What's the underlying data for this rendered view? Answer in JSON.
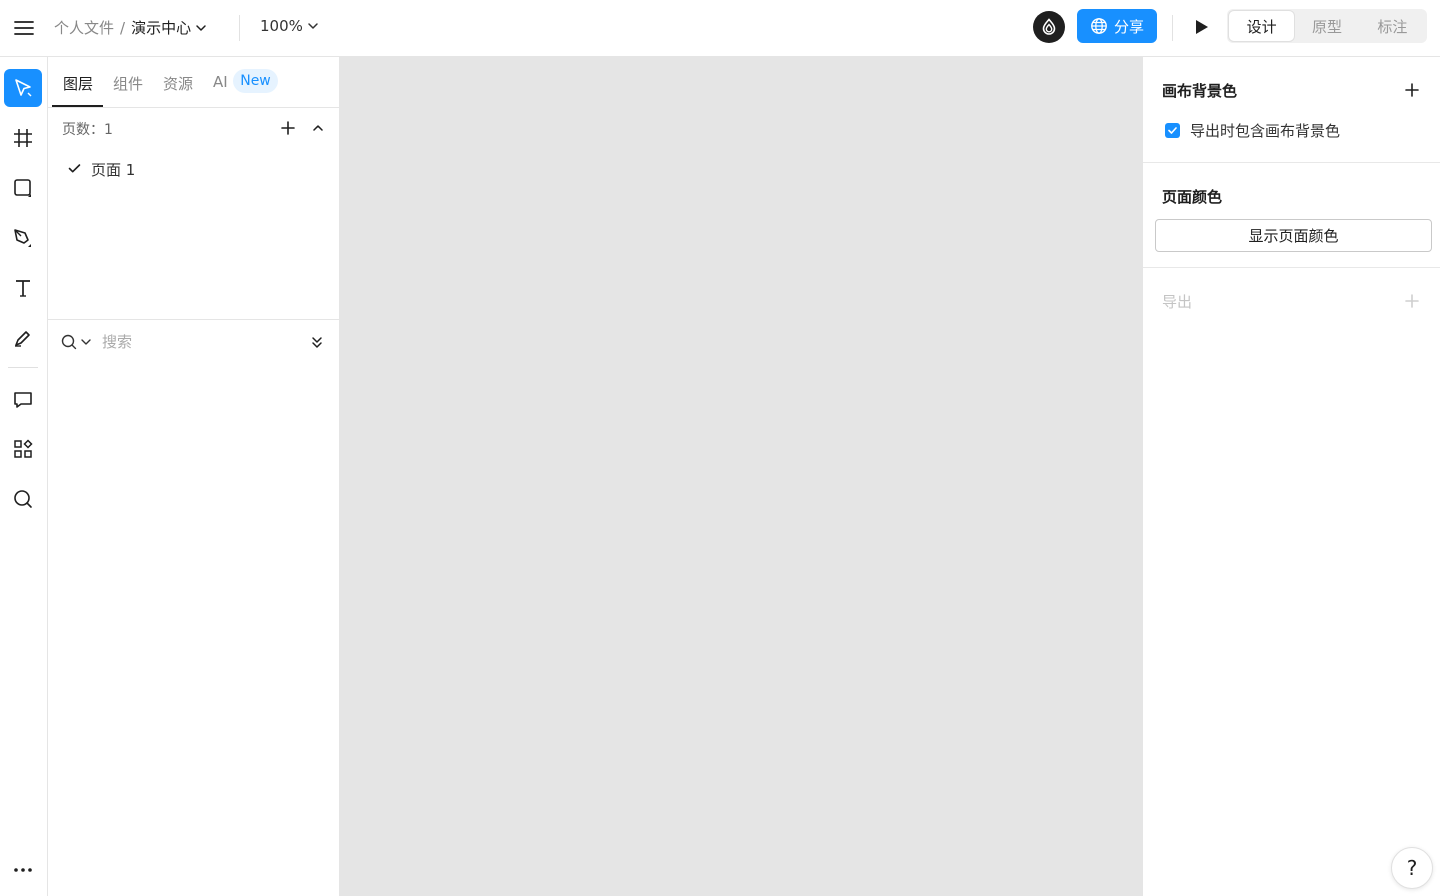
{
  "topbar": {
    "breadcrumb_parent": "个人文件",
    "breadcrumb_sep": "/",
    "file_name": "演示中心",
    "zoom": "100%",
    "share_label": "分享",
    "modes": [
      "设计",
      "原型",
      "标注"
    ],
    "active_mode": "设计"
  },
  "toolbar": {
    "tools": [
      "move-tool",
      "frame-tool",
      "shape-tool",
      "pen-tool",
      "text-tool",
      "pencil-tool",
      "comment-tool",
      "plugins-tool",
      "search-tool",
      "more-tool"
    ]
  },
  "layers_panel": {
    "tabs": [
      "图层",
      "组件",
      "资源",
      "AI"
    ],
    "ai_badge": "New",
    "pages_label": "页数：1",
    "pages": [
      "页面 1"
    ],
    "search_placeholder": "搜索"
  },
  "right_panel": {
    "canvas_bg_title": "画布背景色",
    "include_bg_label": "导出时包含画布背景色",
    "include_bg_checked": true,
    "page_color_title": "页面颜色",
    "show_page_color_button": "显示页面颜色",
    "export_title": "导出"
  },
  "help_label": "?",
  "colors": {
    "accent": "#1890ff",
    "canvas": "#e5e5e5"
  }
}
